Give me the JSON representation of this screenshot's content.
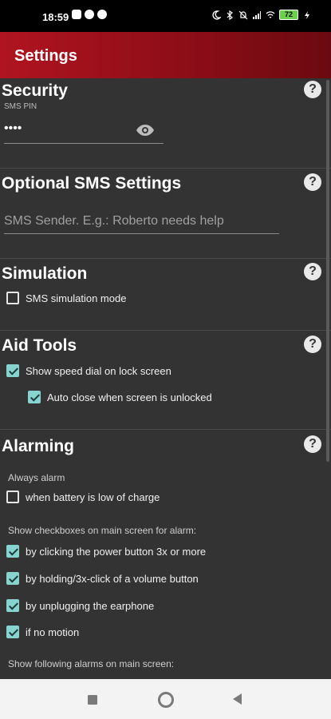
{
  "status": {
    "time": "18:59",
    "battery": "72"
  },
  "appbar": {
    "title": "Settings"
  },
  "security": {
    "title": "Security",
    "help": "?",
    "sms_pin_label": "SMS PIN",
    "sms_pin_value": "••••"
  },
  "optional_sms": {
    "title": "Optional SMS Settings",
    "help": "?",
    "sender_placeholder": "SMS Sender. E.g.: Roberto needs help"
  },
  "simulation": {
    "title": "Simulation",
    "help": "?",
    "sms_simulation_label": "SMS simulation mode",
    "sms_simulation_checked": false
  },
  "aid_tools": {
    "title": "Aid Tools",
    "help": "?",
    "speed_dial_label": "Show speed dial on lock screen",
    "speed_dial_checked": true,
    "auto_close_label": "Auto close when screen is unlocked",
    "auto_close_checked": true
  },
  "alarming": {
    "title": "Alarming",
    "help": "?",
    "always_alarm_label": "Always alarm",
    "battery_low_label": "when battery is low of charge",
    "battery_low_checked": false,
    "show_checkboxes_label": "Show checkboxes on main screen for alarm:",
    "options": [
      {
        "label": "by clicking the power button 3x or more",
        "checked": true
      },
      {
        "label": "by holding/3x-click of a volume button",
        "checked": true
      },
      {
        "label": "by unplugging the earphone",
        "checked": true
      },
      {
        "label": "if no motion",
        "checked": true
      }
    ],
    "show_following_label": "Show following alarms on main screen:"
  },
  "colors": {
    "accent": "#86d3cf",
    "appbar": "#b01420",
    "background": "#333333"
  }
}
